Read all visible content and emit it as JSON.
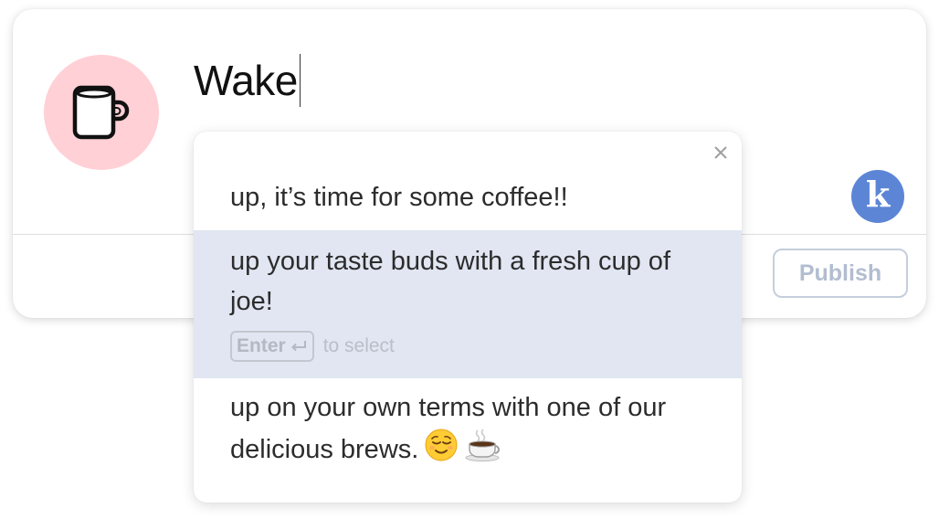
{
  "composer": {
    "text": "Wake",
    "avatar_icon": "coffee-mug-icon",
    "avatar_color": "#ffd0d6",
    "assistant_badge": "k",
    "assistant_color": "#5d85d6",
    "publish_label": "Publish"
  },
  "suggestions": {
    "items": [
      {
        "text": "up, it’s time for some coffee!!",
        "highlighted": false
      },
      {
        "text": "up your taste buds with a fresh cup of joe!",
        "highlighted": true
      },
      {
        "text": "up on your own terms with one of our delicious brews.",
        "highlighted": false,
        "emojis": [
          "relieved-face-icon",
          "hot-beverage-icon"
        ]
      }
    ],
    "hint": {
      "key_label": "Enter",
      "key_icon": "return-arrow-icon",
      "text": "to select"
    },
    "highlight_color": "#e1e6f2"
  }
}
